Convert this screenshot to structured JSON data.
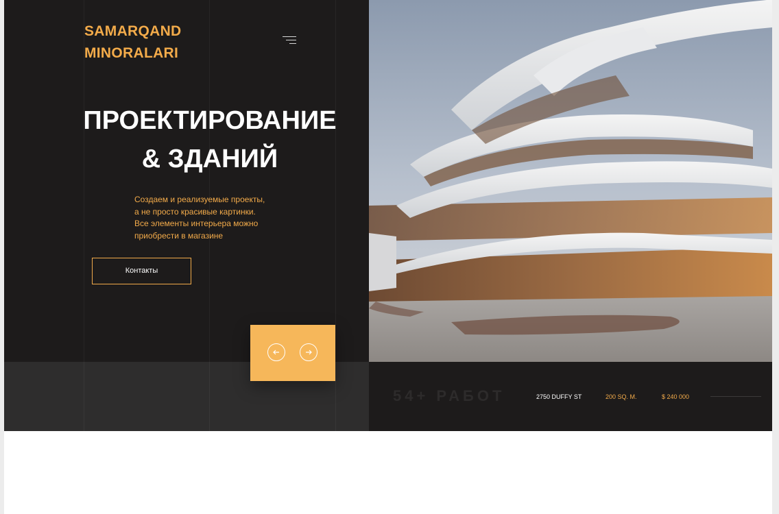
{
  "brand": {
    "line1": "SAMARQAND",
    "line2": "MINORALARI",
    "color": "#f3ab4a"
  },
  "hero": {
    "title_line1": "ПРОЕКТИРОВАНИЕ",
    "title_line2": "& ЗДАНИЙ",
    "description": [
      "Создаем и реализуемые проекты,",
      "а не просто красивые картинки.",
      "Все элементы интерьера можно",
      "приобрести в магазине"
    ],
    "contact_button": "Контакты"
  },
  "icons": {
    "menu": "menu-icon",
    "prev": "arrow-left-icon",
    "next": "arrow-right-icon"
  },
  "stats": {
    "works": "54+ РАБОТ",
    "address": "2750 DUFFY ST",
    "area": "200 SQ. M.",
    "price": "$ 240 000"
  },
  "colors": {
    "accent": "#f3ab4a",
    "slider_bg": "#f6b75a",
    "dark": "#1d1b1b",
    "dark_gray": "#2e2d2d"
  }
}
